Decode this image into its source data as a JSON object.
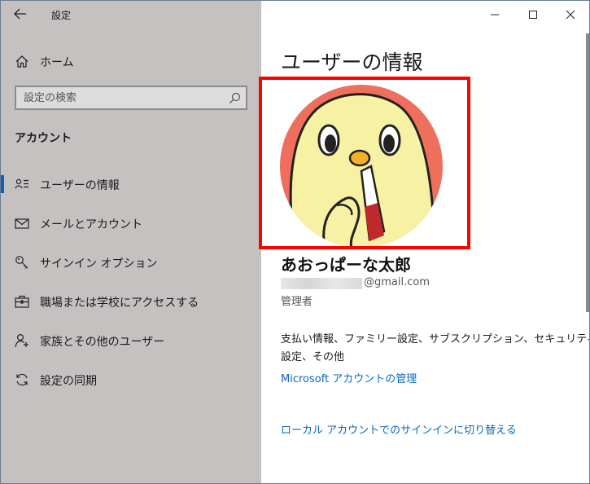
{
  "app": {
    "title": "設定"
  },
  "sidebar": {
    "home_label": "ホーム",
    "search_placeholder": "設定の検索",
    "section_title": "アカウント",
    "items": [
      {
        "label": "ユーザーの情報",
        "icon": "user-info-icon",
        "selected": true
      },
      {
        "label": "メールとアカウント",
        "icon": "mail-icon",
        "selected": false
      },
      {
        "label": "サインイン オプション",
        "icon": "key-icon",
        "selected": false
      },
      {
        "label": "職場または学校にアクセスする",
        "icon": "briefcase-icon",
        "selected": false
      },
      {
        "label": "家族とその他のユーザー",
        "icon": "add-user-icon",
        "selected": false
      },
      {
        "label": "設定の同期",
        "icon": "sync-icon",
        "selected": false
      }
    ]
  },
  "content": {
    "page_title": "ユーザーの情報",
    "user_name": "あおっぱーな太郎",
    "email_visible": "@gmail.com",
    "role": "管理者",
    "info_line1": "支払い情報、ファミリー設定、サブスクリプション、セキュリティ",
    "info_line2": "設定、その他",
    "manage_link": "Microsoft アカウントの管理",
    "switch_link": "ローカル アカウントでのサインインに切り替える"
  },
  "colors": {
    "sidebar_bg": "#c5c1c1",
    "accent": "#0a63b4",
    "link": "#0a66c2",
    "highlight_frame": "#ff0000",
    "avatar_bg": "#ee6f5c"
  }
}
